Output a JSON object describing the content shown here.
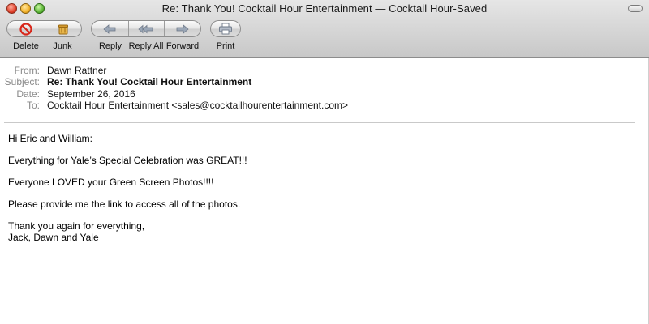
{
  "window": {
    "title": "Re: Thank You! Cocktail Hour Entertainment — Cocktail Hour-Saved"
  },
  "toolbar": {
    "delete_label": "Delete",
    "junk_label": "Junk",
    "reply_label": "Reply",
    "reply_all_label": "Reply All",
    "forward_label": "Forward",
    "print_label": "Print",
    "icons": {
      "delete": "delete-icon",
      "junk": "junk-icon",
      "reply": "reply-icon",
      "reply_all": "reply-all-icon",
      "forward": "forward-icon",
      "print": "print-icon"
    },
    "colors": {
      "delete_red": "#d8261a",
      "junk_amber": "#c98a1e"
    }
  },
  "message": {
    "headers": {
      "from_label": "From:",
      "from_value": "Dawn Rattner",
      "subject_label": "Subject:",
      "subject_value": "Re: Thank You! Cocktail Hour Entertainment",
      "date_label": "Date:",
      "date_value": "September 26, 2016",
      "to_label": "To:",
      "to_value": "Cocktail Hour Entertainment <sales@cocktailhourentertainment.com>"
    },
    "body": {
      "greeting": "Hi Eric and William:",
      "line1": "Everything for Yale’s Special Celebration was GREAT!!!",
      "line2": "Everyone LOVED your Green Screen Photos!!!!",
      "line3": "Please provide me the link to access all of the photos.",
      "closing1": "Thank you again for everything,",
      "closing2": "Jack, Dawn and Yale"
    }
  }
}
